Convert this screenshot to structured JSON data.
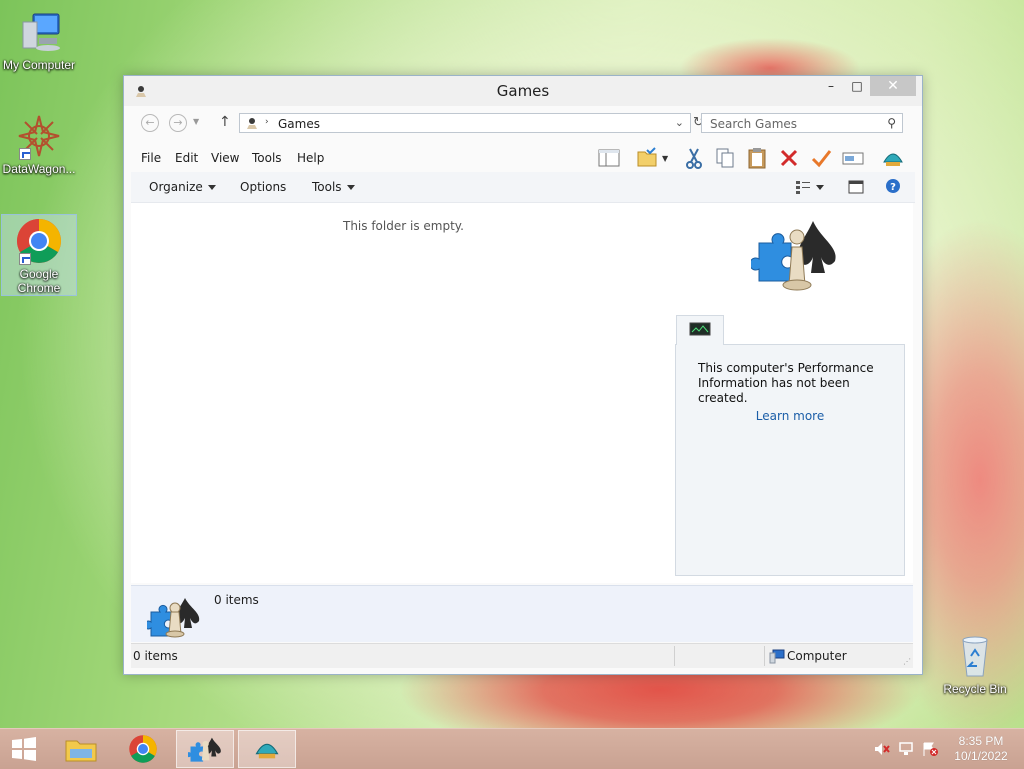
{
  "desktop": {
    "icons": [
      {
        "label": "My Computer"
      },
      {
        "label": "DataWagon..."
      },
      {
        "label": "Google Chrome"
      },
      {
        "label": "Recycle Bin"
      }
    ]
  },
  "window": {
    "title": "Games",
    "controls": {
      "minimize": "–",
      "maximize": "□",
      "close": "✕"
    },
    "address": {
      "crumb": "Games"
    },
    "search": {
      "placeholder": "Search Games"
    },
    "menu": [
      "File",
      "Edit",
      "View",
      "Tools",
      "Help"
    ],
    "commands": {
      "organize": "Organize",
      "options": "Options",
      "tools": "Tools"
    },
    "content": {
      "empty_text": "This folder is empty."
    },
    "perf_panel": {
      "message": "This computer's Performance Information has not been created.",
      "link": "Learn more"
    },
    "details": {
      "count": "0 items"
    },
    "status": {
      "items": "0 items",
      "location": "Computer"
    }
  },
  "taskbar": {
    "time": "8:35 PM",
    "date": "10/1/2022"
  },
  "colors": {
    "accent_link": "#1c5ea8",
    "taskbar": "#cfa898",
    "close_button": "#c7c7c7"
  }
}
